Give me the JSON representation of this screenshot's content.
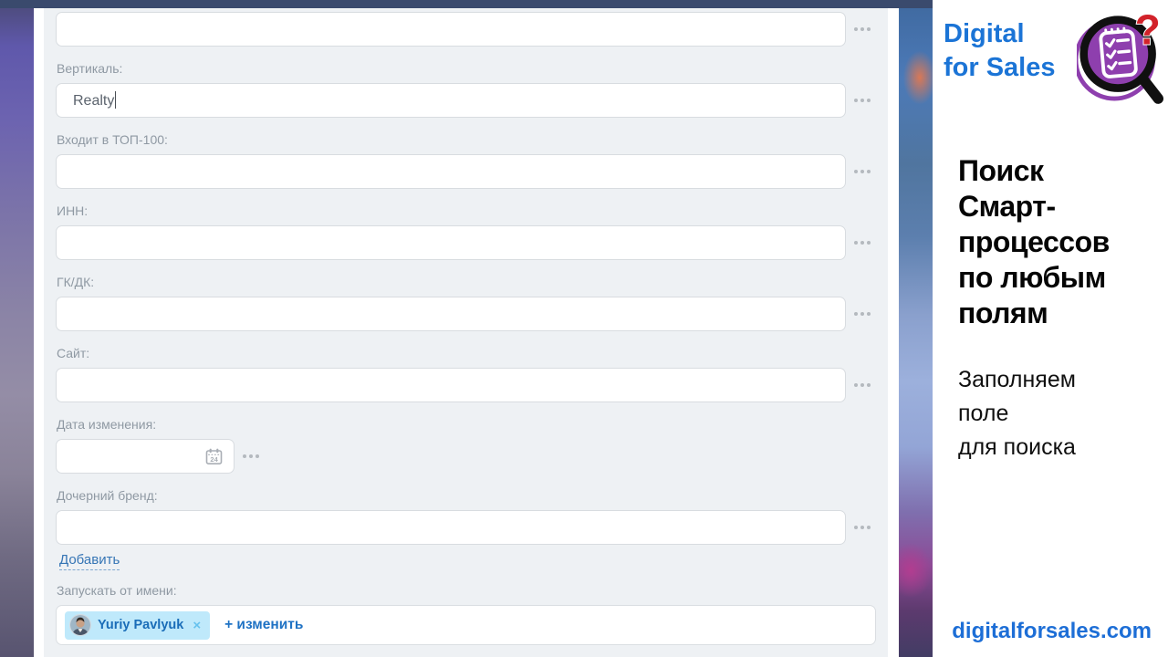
{
  "colors": {
    "topbar_navy": "#3a4a6d",
    "panel_bg": "#eef1f4",
    "link_blue": "#3575b5",
    "chip_bg": "#bfe9fb",
    "chip_text_blue": "#1a6db8",
    "logo_blue": "#1b74d6",
    "website_blue": "#1d6ed6",
    "icon_purple": "#8e3fae",
    "icon_red": "#d2222a"
  },
  "form": {
    "fields": [
      {
        "label": "",
        "value": ""
      },
      {
        "label": "Вертикаль:",
        "value": "Realty"
      },
      {
        "label": "Входит в ТОП-100:",
        "value": ""
      },
      {
        "label": "ИНН:",
        "value": ""
      },
      {
        "label": "ГК/ДК:",
        "value": ""
      },
      {
        "label": "Сайт:",
        "value": ""
      },
      {
        "label": "Дата изменения:",
        "value": "",
        "type": "date",
        "calendar_icon": "calendar-24"
      },
      {
        "label": "Дочерний бренд:",
        "value": ""
      }
    ],
    "field_menu_icon": "ellipsis",
    "add_link_label": "Добавить",
    "run_as_label": "Запускать от имени:",
    "run_as_chip": {
      "name": "Yuriy Pavlyuk",
      "avatar_icon": "user-photo",
      "remove_label": "×"
    },
    "change_link_label": "+ изменить"
  },
  "sidebar": {
    "logo": {
      "line1": "Digital",
      "line2": "for Sales",
      "icon": "checklist-magnifier-question"
    },
    "heading_lines": [
      "Поиск",
      "Смарт-",
      "процессов",
      "по любым",
      "полям"
    ],
    "subtitle_lines": [
      "Заполняем",
      "поле",
      "для поиска"
    ],
    "website": "digitalforsales.com"
  }
}
